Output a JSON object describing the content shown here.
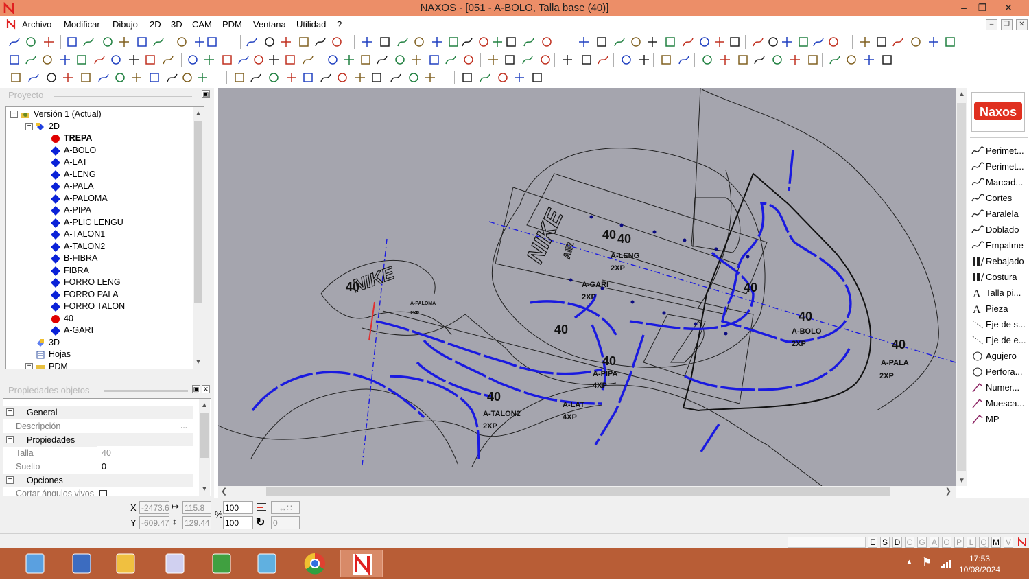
{
  "window": {
    "title": "NAXOS - [051 - A-BOLO, Talla base (40)]",
    "app_icon": "naxos-n-icon"
  },
  "menu": [
    "Archivo",
    "Modificar",
    "Dibujo",
    "2D",
    "3D",
    "CAM",
    "PDM",
    "Ventana",
    "Utilidad",
    "?"
  ],
  "project_panel": {
    "title": "Proyecto",
    "tree": [
      {
        "label": "Versión 1 (Actual)",
        "level": 0,
        "icon": "folder-gear-icon",
        "expander": "−"
      },
      {
        "label": "2D",
        "level": 1,
        "icon": "layers-2d-icon",
        "expander": "−"
      },
      {
        "label": "TREPA",
        "level": 2,
        "icon": "red-dot-icon",
        "bold": true
      },
      {
        "label": "A-BOLO",
        "level": 2,
        "icon": "blue-diamond-icon"
      },
      {
        "label": "A-LAT",
        "level": 2,
        "icon": "blue-diamond-icon"
      },
      {
        "label": "A-LENG",
        "level": 2,
        "icon": "blue-diamond-icon"
      },
      {
        "label": "A-PALA",
        "level": 2,
        "icon": "blue-diamond-icon"
      },
      {
        "label": "A-PALOMA",
        "level": 2,
        "icon": "blue-diamond-icon"
      },
      {
        "label": "A-PIPA",
        "level": 2,
        "icon": "blue-diamond-icon"
      },
      {
        "label": "A-PLIC LENGU",
        "level": 2,
        "icon": "blue-diamond-icon"
      },
      {
        "label": "A-TALON1",
        "level": 2,
        "icon": "blue-diamond-icon"
      },
      {
        "label": "A-TALON2",
        "level": 2,
        "icon": "blue-diamond-icon"
      },
      {
        "label": "B-FIBRA",
        "level": 2,
        "icon": "blue-diamond-icon"
      },
      {
        "label": "FIBRA",
        "level": 2,
        "icon": "blue-diamond-icon"
      },
      {
        "label": "FORRO LENG",
        "level": 2,
        "icon": "blue-diamond-icon"
      },
      {
        "label": "FORRO PALA",
        "level": 2,
        "icon": "blue-diamond-icon"
      },
      {
        "label": "FORRO TALON",
        "level": 2,
        "icon": "blue-diamond-icon"
      },
      {
        "label": "40",
        "level": 2,
        "icon": "red-dot-icon"
      },
      {
        "label": "A-GARI",
        "level": 2,
        "icon": "blue-diamond-icon"
      },
      {
        "label": "3D",
        "level": 1,
        "icon": "layers-3d-icon"
      },
      {
        "label": "Hojas",
        "level": 1,
        "icon": "sheets-icon"
      },
      {
        "label": "PDM",
        "level": 1,
        "icon": "pdm-folder-icon",
        "expander": "+"
      }
    ]
  },
  "properties_panel": {
    "title": "Propiedades objetos",
    "groups": [
      {
        "name": "General",
        "rows": [
          {
            "label": "Descripción",
            "value": ""
          }
        ]
      },
      {
        "name": "Propiedades",
        "rows": [
          {
            "label": "Talla",
            "value": "40"
          },
          {
            "label": "Suelto",
            "value": "0"
          }
        ]
      },
      {
        "name": "Opciones",
        "rows": [
          {
            "label": "Cortar ángulos vivos",
            "value": ""
          }
        ]
      }
    ],
    "ellipsis": "..."
  },
  "canvas": {
    "labels": [
      {
        "text": "40",
        "kind": "size"
      },
      {
        "text": "40",
        "kind": "size"
      },
      {
        "text": "A-LENG",
        "kind": "piece"
      },
      {
        "text": "2XP",
        "kind": "qty"
      },
      {
        "text": "A-GARI",
        "kind": "piece"
      },
      {
        "text": "2XP",
        "kind": "qty"
      },
      {
        "text": "40",
        "kind": "size"
      },
      {
        "text": "40",
        "kind": "size"
      },
      {
        "text": "A-BOLO",
        "kind": "piece"
      },
      {
        "text": "2XP",
        "kind": "qty"
      },
      {
        "text": "40",
        "kind": "size"
      },
      {
        "text": "A-PALA",
        "kind": "piece"
      },
      {
        "text": "2XP",
        "kind": "qty"
      },
      {
        "text": "40",
        "kind": "size"
      },
      {
        "text": "40",
        "kind": "size"
      },
      {
        "text": "A-PIPA",
        "kind": "piece"
      },
      {
        "text": "4XP",
        "kind": "qty"
      },
      {
        "text": "A-LAT",
        "kind": "piece"
      },
      {
        "text": "4XP",
        "kind": "qty"
      },
      {
        "text": "40",
        "kind": "size"
      },
      {
        "text": "A-TALON2",
        "kind": "piece"
      },
      {
        "text": "2XP",
        "kind": "qty"
      },
      {
        "text": "40",
        "kind": "size"
      },
      {
        "text": "A-PALOMA",
        "kind": "piece"
      },
      {
        "text": "2XP",
        "kind": "qty"
      },
      {
        "text": "NIKE",
        "kind": "logo"
      },
      {
        "text": "NIKE",
        "kind": "logo"
      },
      {
        "text": "AIR",
        "kind": "logo"
      }
    ]
  },
  "right_panel": {
    "logo": "Naxos",
    "tools": [
      {
        "label": "Perimet...",
        "icon": "perimeter-curve-icon"
      },
      {
        "label": "Perimet...",
        "icon": "perimeter-curve-icon"
      },
      {
        "label": "Marcad...",
        "icon": "marker-curve-icon"
      },
      {
        "label": "Cortes",
        "icon": "cuts-curve-icon"
      },
      {
        "label": "Paralela",
        "icon": "parallel-curve-icon"
      },
      {
        "label": "Doblado",
        "icon": "fold-curve-icon"
      },
      {
        "label": "Empalme",
        "icon": "fillet-curve-icon"
      },
      {
        "label": "Rebajado",
        "icon": "skive-icon"
      },
      {
        "label": "Costura",
        "icon": "seam-icon"
      },
      {
        "label": "Talla pi...",
        "icon": "text-size-icon"
      },
      {
        "label": "Pieza",
        "icon": "text-piece-icon"
      },
      {
        "label": "Eje de s...",
        "icon": "axis-dotted-icon"
      },
      {
        "label": "Eje de e...",
        "icon": "axis-dotted-icon"
      },
      {
        "label": "Agujero",
        "icon": "hole-circle-icon"
      },
      {
        "label": "Perfora...",
        "icon": "perforation-circle-icon"
      },
      {
        "label": "Numer...",
        "icon": "numbering-icon"
      },
      {
        "label": "Muesca...",
        "icon": "notch-icon"
      },
      {
        "label": "MP",
        "icon": "mp-icon"
      }
    ]
  },
  "coords": {
    "x_label": "X",
    "y_label": "Y",
    "x": "-2473.6",
    "y": "-609.47",
    "width": "115.8",
    "height": "129.44",
    "pct_label": "%",
    "scale_x": "100",
    "scale_y": "100",
    "rotation": "0"
  },
  "status_letters": [
    "E",
    "S",
    "D",
    "C",
    "G",
    "A",
    "O",
    "P",
    "L",
    "Q",
    "M",
    "V"
  ],
  "status_on": [
    "E",
    "S",
    "D",
    "M"
  ],
  "taskbar": {
    "time": "17:53",
    "date": "10/08/2024",
    "apps": [
      "calculator-icon",
      "remote-desktop-icon",
      "file-explorer-icon",
      "installer-icon",
      "app-green-icon",
      "app-blue-icon",
      "chrome-icon",
      "naxos-taskbar-icon"
    ]
  },
  "colors": {
    "titlebar": "#ec8e68",
    "canvas_bg": "#a5a5ae",
    "taskbar": "#b85d36",
    "piece_blue": "#1a1ae0",
    "diamond_blue": "#0a22d8",
    "dot_red": "#e00000"
  }
}
